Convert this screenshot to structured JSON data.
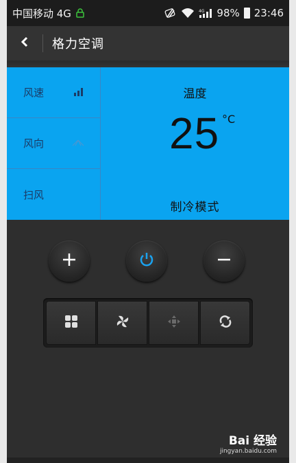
{
  "status_bar": {
    "carrier": "中国移动 4G",
    "battery": "98%",
    "time": "23:46",
    "icons": [
      "lock-icon",
      "nfc-icon",
      "wifi-icon",
      "signal-icon",
      "battery-icon"
    ]
  },
  "header": {
    "title": "格力空调",
    "back_icon": "back-chevron-icon"
  },
  "panel": {
    "background": "#0aa4f0",
    "rows": [
      {
        "label": "风速",
        "icon": "fan-speed-bars-icon"
      },
      {
        "label": "风向",
        "icon": "wind-direction-icon"
      },
      {
        "label": "扫风",
        "icon": ""
      }
    ],
    "temp_label": "温度",
    "temperature": "25",
    "unit": "°C",
    "mode": "制冷模式"
  },
  "controls": {
    "round_buttons": [
      "plus-icon",
      "power-icon",
      "minus-icon"
    ],
    "tray_buttons": [
      "grid-icon",
      "fan-icon",
      "move-icon",
      "swing-icon"
    ]
  },
  "watermark": {
    "brand": "Bai 经验",
    "url": "jingyan.baidu.com"
  }
}
